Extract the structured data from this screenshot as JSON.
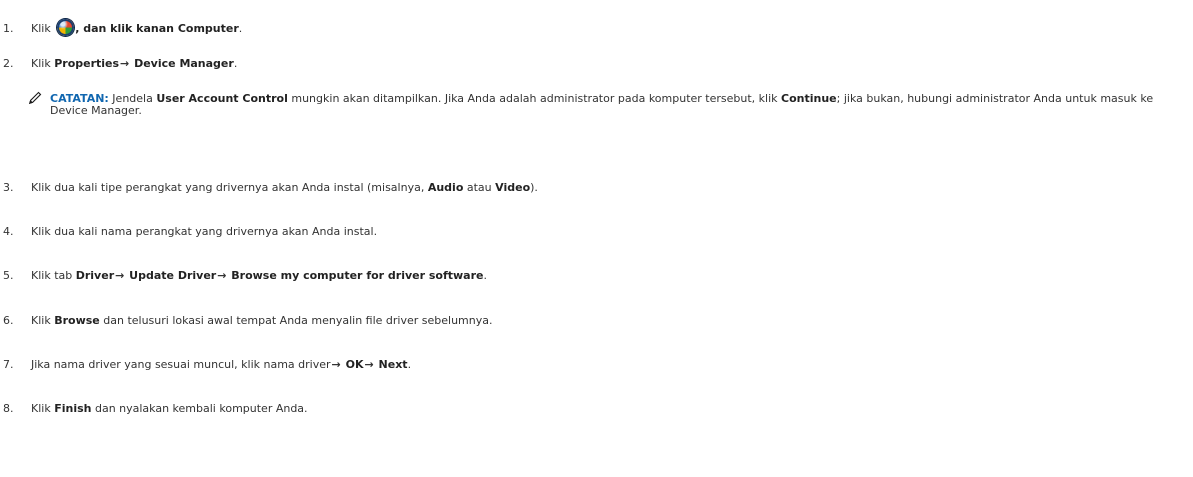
{
  "steps": [
    {
      "num": "1.",
      "t1": "Klik ",
      "t2": ", dan klik kanan ",
      "b1": "Computer",
      "t3": "."
    },
    {
      "num": "2.",
      "t1": "Klik ",
      "b1": "Properties",
      "arrow": "→",
      "b2": " Device Manager",
      "t2": "."
    },
    {
      "num": "3.",
      "t1": "Klik dua kali tipe perangkat yang drivernya akan Anda instal (misalnya, ",
      "b1": "Audio",
      "t2": " atau ",
      "b2": "Video",
      "t3": ")."
    },
    {
      "num": "4.",
      "t1": "Klik dua kali nama perangkat yang drivernya akan Anda instal."
    },
    {
      "num": "5.",
      "t1": "Klik tab ",
      "b1": "Driver",
      "arrow1": "→",
      "b2": " Update Driver",
      "arrow2": "→",
      "b3": " Browse my computer for driver software",
      "t2": "."
    },
    {
      "num": "6.",
      "t1": "Klik ",
      "b1": "Browse",
      "t2": " dan telusuri lokasi awal tempat Anda menyalin file driver sebelumnya."
    },
    {
      "num": "7.",
      "t1": "Jika nama driver yang sesuai muncul, klik nama driver",
      "arrow1": "→",
      "b1": " OK",
      "arrow2": "→",
      "b2": " Next",
      "t2": "."
    },
    {
      "num": "8.",
      "t1": "Klik ",
      "b1": "Finish",
      "t2": " dan nyalakan kembali komputer Anda."
    }
  ],
  "note": {
    "label": "CATATAN:",
    "t1": " Jendela ",
    "b1": "User Account Control",
    "t2": " mungkin akan ditampilkan. Jika Anda adalah administrator pada komputer tersebut, klik ",
    "b2": "Continue",
    "t3": "; jika bukan, hubungi administrator Anda untuk masuk ke Device Manager."
  },
  "icons": {
    "start": "windows-start-orb-icon",
    "note": "pencil-note-icon"
  },
  "colors": {
    "text": "#333333",
    "note_label": "#1167b0"
  }
}
